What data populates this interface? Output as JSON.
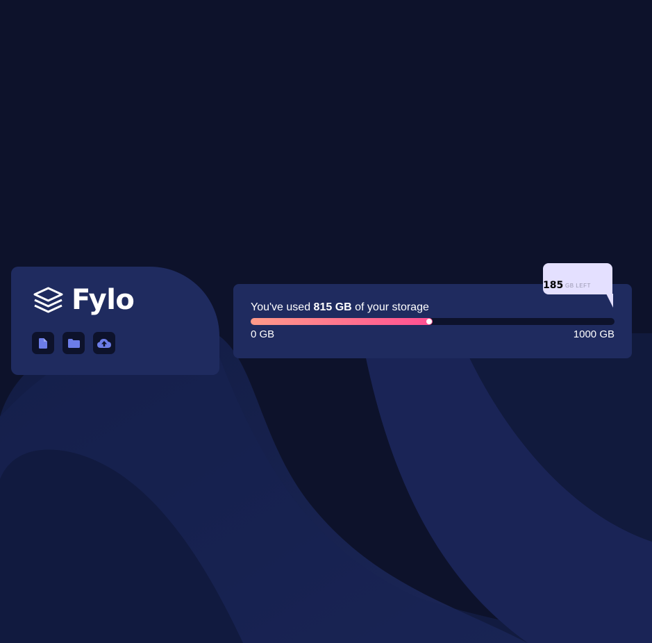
{
  "brand": {
    "name": "Fylo"
  },
  "toolbar": {
    "buttons": [
      {
        "name": "file-icon"
      },
      {
        "name": "folder-icon"
      },
      {
        "name": "upload-icon"
      }
    ]
  },
  "storage": {
    "used_prefix": "You've used ",
    "used_value": "815 GB",
    "used_suffix": " of your storage",
    "used_fraction": 0.5,
    "scale_min": "0 GB",
    "scale_max": "1000 GB",
    "remaining_value": "185",
    "remaining_unit": "GB LEFT"
  },
  "colors": {
    "page_background": "#0d122b",
    "card_background": "#1f2b5f",
    "gradient_start": "#fe9b8a",
    "gradient_end": "#ff4f93",
    "bubble_background": "#e4e0ff",
    "icon_color": "#6c7de8"
  }
}
